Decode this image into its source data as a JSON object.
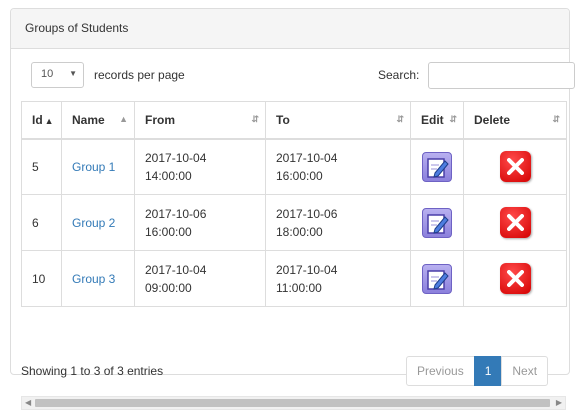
{
  "panel": {
    "title": "Groups of Students"
  },
  "controls": {
    "length_value": "10",
    "length_label": "records per page",
    "search_label": "Search:",
    "search_value": ""
  },
  "table": {
    "headers": {
      "id": "Id",
      "name": "Name",
      "from": "From",
      "to": "To",
      "edit": "Edit",
      "delete": "Delete"
    },
    "rows": [
      {
        "id": "5",
        "name": "Group 1",
        "from_date": "2017-10-04",
        "from_time": "14:00:00",
        "to_date": "2017-10-04",
        "to_time": "16:00:00"
      },
      {
        "id": "6",
        "name": "Group 2",
        "from_date": "2017-10-06",
        "from_time": "16:00:00",
        "to_date": "2017-10-06",
        "to_time": "18:00:00"
      },
      {
        "id": "10",
        "name": "Group 3",
        "from_date": "2017-10-04",
        "from_time": "09:00:00",
        "to_date": "2017-10-04",
        "to_time": "11:00:00"
      }
    ]
  },
  "info": "Showing 1 to 3 of 3 entries",
  "pagination": {
    "previous": "Previous",
    "current": "1",
    "next": "Next"
  },
  "icons": {
    "edit": "edit-pencil-icon",
    "delete": "delete-x-icon"
  },
  "colors": {
    "link": "#337ab7",
    "active_page": "#337ab7",
    "delete": "#e00000",
    "edit": "#8b80dc"
  }
}
